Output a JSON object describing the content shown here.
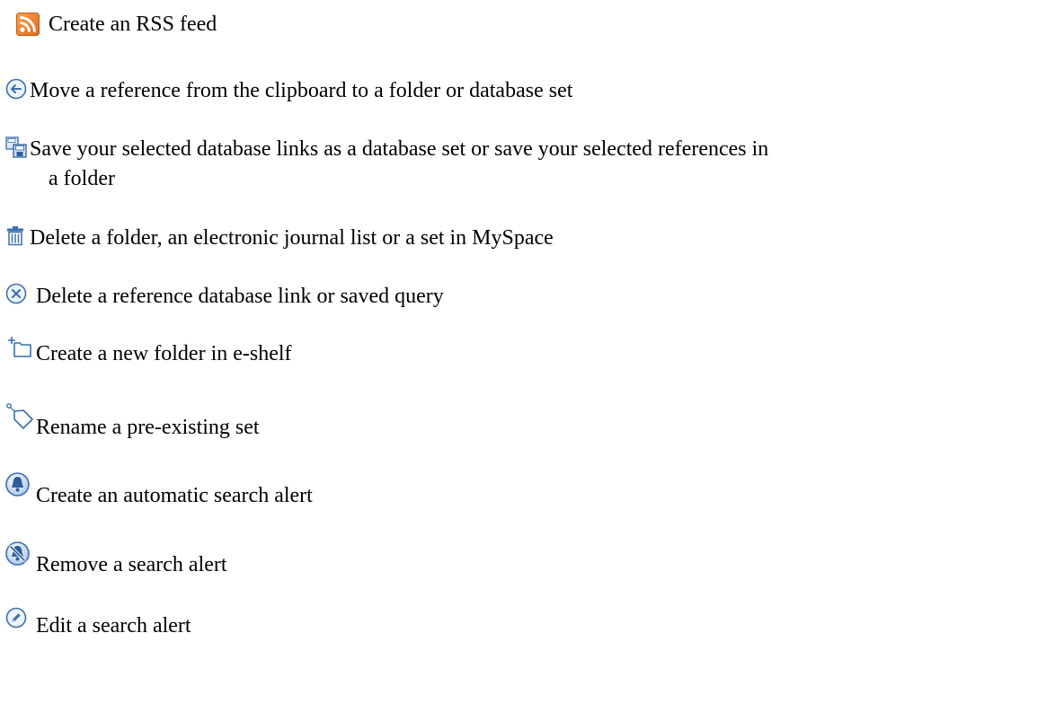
{
  "items": [
    {
      "icon": "rss-icon",
      "text": "Create an RSS feed"
    },
    {
      "icon": "move-arrow-icon",
      "text": "Move a reference from the clipboard to a folder or database set"
    },
    {
      "icon": "save-icon",
      "text_line1": "Save your selected database links as a database set or save your selected references in",
      "text_line2": "a folder"
    },
    {
      "icon": "trash-icon",
      "text": "Delete a folder, an electronic journal list or a set in MySpace"
    },
    {
      "icon": "delete-x-icon",
      "text": "Delete a reference database link or saved query"
    },
    {
      "icon": "new-folder-icon",
      "text": "Create a new folder in e-shelf"
    },
    {
      "icon": "tag-icon",
      "text": "Rename a pre-existing set"
    },
    {
      "icon": "alert-bell-icon",
      "text": "Create an automatic search alert"
    },
    {
      "icon": "remove-alert-icon",
      "text": "Remove a search alert"
    },
    {
      "icon": "edit-alert-icon",
      "text": "Edit a search alert"
    }
  ],
  "colors": {
    "rss_orange": "#f47b20",
    "icon_blue": "#3a6fb0",
    "icon_light_blue": "#cfe0f5"
  }
}
